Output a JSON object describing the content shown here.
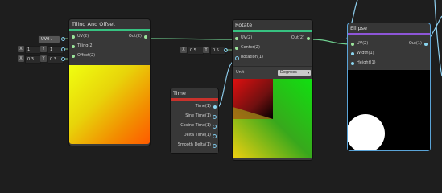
{
  "tiling_node": {
    "title": "Tiling And Offset",
    "inputs": [
      "UV(2)",
      "Tiling(2)",
      "Offset(2)"
    ],
    "output": "Out(2)",
    "accent": "#37c281"
  },
  "tiling_inline": {
    "uv_select": "UV0",
    "tiling": {
      "x_label": "X",
      "x": "1",
      "y_label": "Y",
      "y": "1"
    },
    "offset": {
      "x_label": "X",
      "x": "0.3",
      "y_label": "Y",
      "y": "0.3"
    }
  },
  "rotate_node": {
    "title": "Rotate",
    "inputs": [
      "UV(2)",
      "Center(2)",
      "Rotation(1)"
    ],
    "output": "Out(2)",
    "unit_label": "Unit",
    "unit_value": "Degrees",
    "accent": "#37c281"
  },
  "rotate_inline": {
    "center": {
      "x_label": "X",
      "x": "0.5",
      "y_label": "Y",
      "y": "0.5"
    }
  },
  "time_node": {
    "title": "Time",
    "outputs": [
      "Time(1)",
      "Sine Time(1)",
      "Cosine Time(1)",
      "Delta Time(1)",
      "Smooth Delta(1)"
    ],
    "accent": "#c8322c"
  },
  "ellipse_node": {
    "title": "Ellipse",
    "inputs": [
      "UV(2)",
      "Width(1)",
      "Height(1)"
    ],
    "output": "Out(1)",
    "accent": "#8e56d8",
    "selection": "#5aa4d8"
  }
}
